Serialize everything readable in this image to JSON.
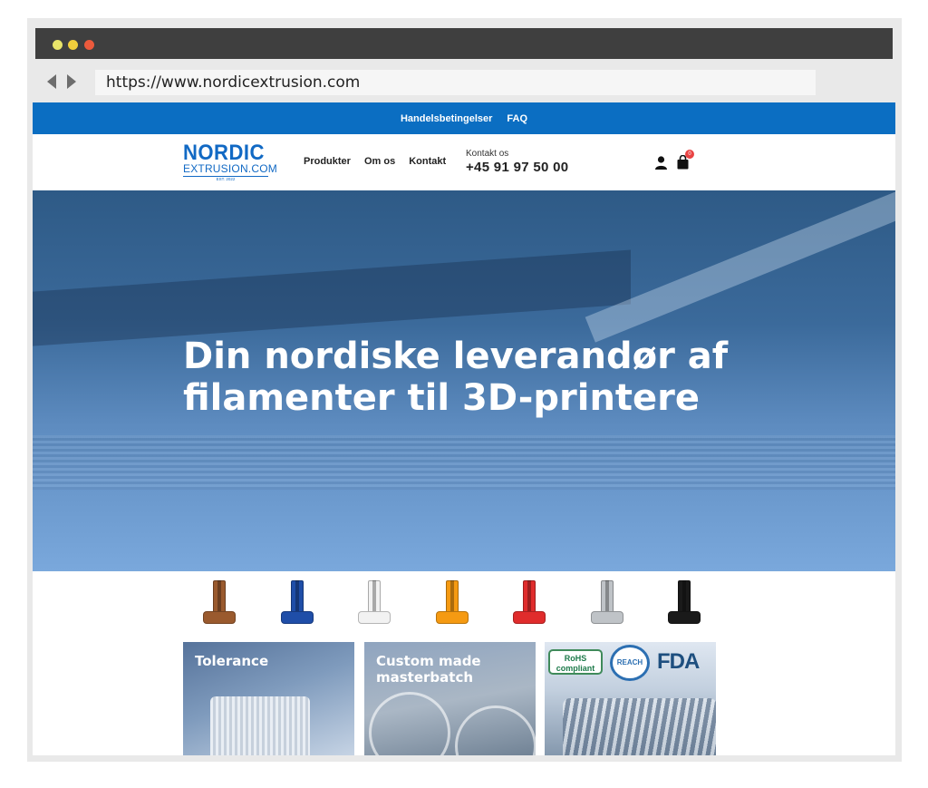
{
  "browser": {
    "url": "https://www.nordicextrusion.com"
  },
  "topbar": {
    "links": [
      "Handelsbetingelser",
      "FAQ"
    ]
  },
  "header": {
    "logo": {
      "line1": "NORDIC",
      "line2": "EXTRUSION.COM",
      "line3": "EST. 2022"
    },
    "nav": [
      "Produkter",
      "Om os",
      "Kontakt"
    ],
    "contact_label": "Kontakt os",
    "contact_phone": "+45 91 97 50 00",
    "cart_count": "0"
  },
  "hero": {
    "headline": "Din nordiske leverandør af filamenter til 3D-printere"
  },
  "spools": [
    {
      "name": "spool-brown",
      "color": "#9a5a2e"
    },
    {
      "name": "spool-blue",
      "color": "#1f4ea8"
    },
    {
      "name": "spool-white",
      "color": "#f2f2f2"
    },
    {
      "name": "spool-orange",
      "color": "#f59a12"
    },
    {
      "name": "spool-red",
      "color": "#e02c2c"
    },
    {
      "name": "spool-silver",
      "color": "#bfc3c7"
    },
    {
      "name": "spool-black",
      "color": "#1a1a1a"
    }
  ],
  "cards": [
    {
      "title": "Tolerance"
    },
    {
      "title": "Custom made masterbatch"
    },
    {
      "title": "",
      "badges": [
        "RoHS compliant",
        "REACH",
        "FDA"
      ]
    }
  ],
  "colors": {
    "brand_blue": "#0b6ec2",
    "badge_red": "#e94343"
  }
}
